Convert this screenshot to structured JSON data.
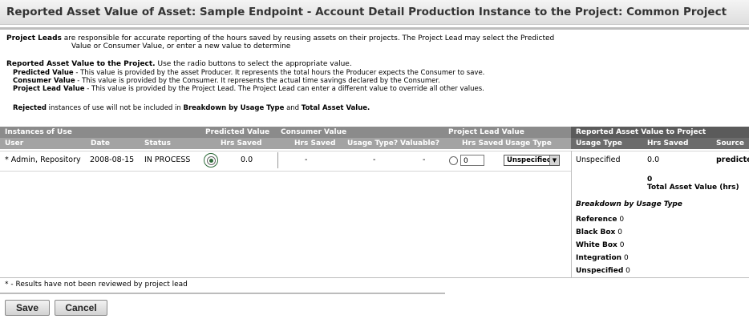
{
  "title": "Reported Asset Value of Asset: Sample Endpoint - Account Detail Production Instance to the Project: Common Project",
  "intro": {
    "leads_bold": "Project Leads",
    "leads_text1": "are responsible for accurate reporting of the hours saved by reusing assets on their projects. The Project Lead may select the Predicted",
    "leads_text2": "Value or Consumer Value, or enter a new value to determine",
    "rav_bold": "Reported Asset Value to the Project.",
    "rav_text": "Use the radio buttons to select the appropriate value.",
    "pv_bold": "Predicted Value",
    "pv_text": "- This value is provided by the asset Producer. It represents the total hours the Producer expects the Consumer to save.",
    "cv_bold": "Consumer Value",
    "cv_text": "- This value is provided by the Consumer. It represents the actual time savings declared by the Consumer.",
    "plv_bold": "Project Lead Value",
    "plv_text": "- This value is provided by the Project Lead. The Project Lead can enter a different value to override all other values.",
    "rej_bold": "Rejected",
    "rej_text": "instances of use will not be included in",
    "rej_b2": "Breakdown by Usage Type",
    "rej_and": "and",
    "rej_b3": "Total Asset Value."
  },
  "table": {
    "group_headers": {
      "instances": "Instances of Use",
      "predicted": "Predicted Value",
      "consumer": "Consumer Value",
      "lead": "Project Lead Value",
      "reported": "Reported Asset Value to Project"
    },
    "columns": {
      "user": "User",
      "date": "Date",
      "status": "Status",
      "pv_hrs": "Hrs Saved",
      "cv_hrs": "Hrs Saved",
      "cv_usage": "Usage Type?",
      "cv_valuable": "Valuable?",
      "pl_hrs": "Hrs Saved",
      "pl_usage": "Usage Type",
      "r_usage": "Usage Type",
      "r_hrs": "Hrs Saved",
      "r_source": "Source"
    },
    "row": {
      "user": "* Admin, Repository",
      "date": "2008-08-15",
      "status": "IN PROCESS",
      "pv_hrs": "0.0",
      "cv_hrs": "-",
      "cv_usage": "-",
      "cv_valuable": "-",
      "pl_hrs_value": "0",
      "pl_usage_selected": "Unspecified",
      "r_usage": "Unspecified",
      "r_hrs": "0.0",
      "r_source": "predicte"
    }
  },
  "totals": {
    "value": "0",
    "label": "Total Asset Value (hrs)"
  },
  "breakdown": {
    "title": "Breakdown by Usage Type",
    "items": [
      {
        "label": "Reference",
        "value": "0"
      },
      {
        "label": "Black Box",
        "value": "0"
      },
      {
        "label": "White Box",
        "value": "0"
      },
      {
        "label": "Integration",
        "value": "0"
      },
      {
        "label": "Unspecified",
        "value": "0"
      }
    ]
  },
  "footnote": "* - Results have not been reviewed by project lead",
  "buttons": {
    "save": "Save",
    "cancel": "Cancel"
  }
}
